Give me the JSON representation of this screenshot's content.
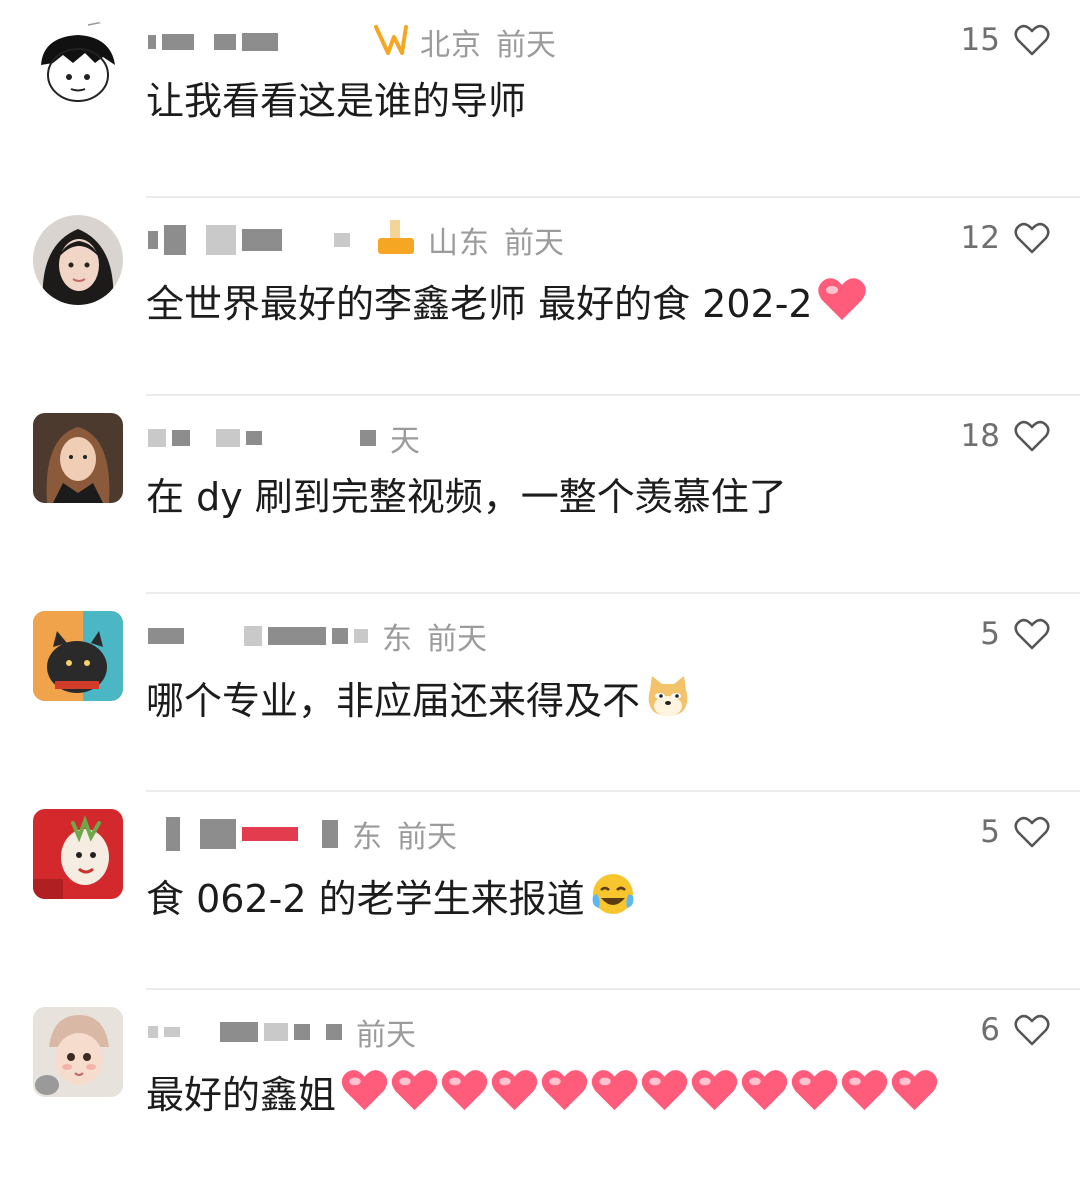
{
  "comments": [
    {
      "location": "北京",
      "time": "前天",
      "likes": "15",
      "text": "让我看看这是谁的导师",
      "emojis": [],
      "avatar_icon": "cartoon-boy-avatar"
    },
    {
      "location": "山东",
      "time": "前天",
      "likes": "12",
      "text": "全世界最好的李鑫老师 最好的食 202-2",
      "emojis": [
        "pink-heart"
      ],
      "avatar_icon": "girl-photo-avatar"
    },
    {
      "location": "",
      "time": "天",
      "likes": "18",
      "text": "在 dy 刷到完整视频，一整个羡慕住了",
      "emojis": [],
      "avatar_icon": "movie-character-avatar"
    },
    {
      "location": "东",
      "time": "前天",
      "likes": "5",
      "text": "哪个专业，非应届还来得及不",
      "emojis": [
        "doge-face"
      ],
      "avatar_icon": "cartoon-cat-avatar"
    },
    {
      "location": "东",
      "time": "前天",
      "likes": "5",
      "text": "食 062-2 的老学生来报道",
      "emojis": [
        "laughing-tears-face"
      ],
      "avatar_icon": "red-dragon-avatar"
    },
    {
      "location": "",
      "time": "前天",
      "likes": "6",
      "text": "最好的鑫姐",
      "emojis": [
        "pink-heart",
        "pink-heart",
        "pink-heart",
        "pink-heart",
        "pink-heart",
        "pink-heart",
        "pink-heart",
        "pink-heart",
        "pink-heart",
        "pink-heart",
        "pink-heart",
        "pink-heart"
      ],
      "avatar_icon": "baby-girl-avatar"
    }
  ],
  "colors": {
    "meta_gray": "#9b9b9b",
    "count_gray": "#6f6f6f",
    "text": "#1c1c1c",
    "heart_pink": "#ff5c7c",
    "badge_orange": "#f5a623"
  }
}
